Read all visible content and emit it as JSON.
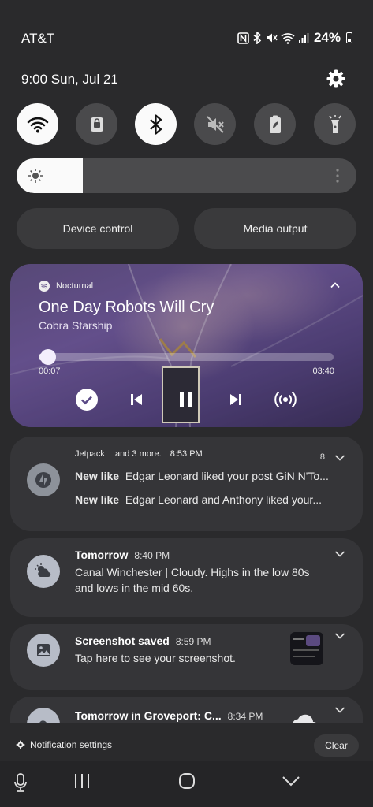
{
  "status_bar": {
    "carrier": "AT&T",
    "battery_pct": "24%",
    "icons": [
      "nfc-icon",
      "bluetooth-icon",
      "mute-icon",
      "wifi-icon",
      "signal-icon",
      "battery-icon"
    ]
  },
  "header": {
    "datetime": "9:00  Sun, Jul 21"
  },
  "quick_toggles": [
    {
      "name": "wifi",
      "on": true
    },
    {
      "name": "lock",
      "on": false
    },
    {
      "name": "bluetooth",
      "on": true
    },
    {
      "name": "mute",
      "on": false
    },
    {
      "name": "power-saving",
      "on": false
    },
    {
      "name": "flashlight",
      "on": false
    }
  ],
  "brightness": {
    "level": 0.195
  },
  "pills": {
    "device_control": "Device control",
    "media_output": "Media output"
  },
  "media": {
    "app": "Nocturnal",
    "song": "One Day Robots Will Cry",
    "artist": "Cobra Starship",
    "elapsed": "00:07",
    "total": "03:40",
    "progress": 0.035
  },
  "notifications": {
    "jetpack": {
      "app": "Jetpack",
      "more": "and 3 more.",
      "time": "8:53 PM",
      "count": "8",
      "lines": [
        {
          "title": "New like",
          "text": "Edgar Leonard liked your post GiN N'To..."
        },
        {
          "title": "New like",
          "text": "Edgar Leonard and Anthony liked your..."
        }
      ]
    },
    "tomorrow": {
      "title": "Tomorrow",
      "time": "8:40 PM",
      "line1": "Canal Winchester | Cloudy. Highs in the low 80s",
      "line2": "and lows in the mid 60s."
    },
    "screenshot": {
      "title": "Screenshot saved",
      "time": "8:59 PM",
      "text": "Tap here to see your screenshot."
    },
    "groveport": {
      "title": "Tomorrow in Groveport: C...",
      "time": "8:34 PM"
    }
  },
  "bottom": {
    "notification_settings": "Notification settings",
    "clear": "Clear"
  }
}
